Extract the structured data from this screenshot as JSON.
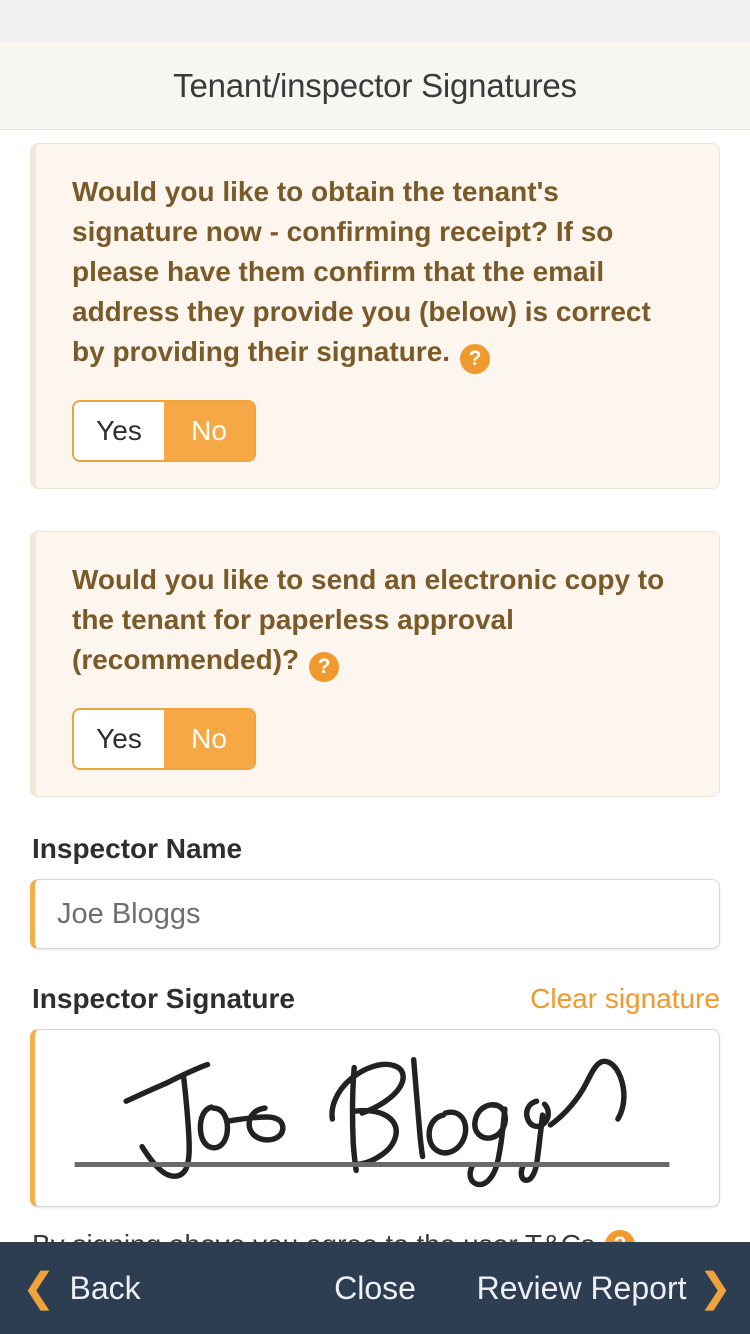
{
  "header": {
    "title": "Tenant/inspector Signatures"
  },
  "questions": [
    {
      "text": "Would you like to obtain the tenant's signature now - confirming receipt? If so please have them confirm that the email address they provide you (below) is correct by providing their signature.",
      "help_icon": "question-mark-icon",
      "help_glyph": "?",
      "options": [
        {
          "label": "Yes",
          "selected": false
        },
        {
          "label": "No",
          "selected": true
        }
      ]
    },
    {
      "text": "Would you like to send an electronic copy to the tenant for paperless approval (recommended)?",
      "help_icon": "question-mark-icon",
      "help_glyph": "?",
      "options": [
        {
          "label": "Yes",
          "selected": false
        },
        {
          "label": "No",
          "selected": true
        }
      ]
    }
  ],
  "inspector_name": {
    "label": "Inspector Name",
    "value": "Joe Bloggs",
    "placeholder": "Inspector Name"
  },
  "inspector_signature": {
    "label": "Inspector Signature",
    "clear_label": "Clear signature",
    "signature_text": "Joe Bloggs"
  },
  "terms": {
    "text": "By signing above you agree to the user T&Cs",
    "help_icon": "question-mark-icon",
    "help_glyph": "?"
  },
  "bottom_nav": {
    "back_label": "Back",
    "close_label": "Close",
    "review_label": "Review Report",
    "chevron_left": "❮",
    "chevron_right": "❯"
  },
  "colors": {
    "accent_orange": "#F0A33C",
    "selected_orange": "#F5A843",
    "question_brown": "#7A5A28",
    "card_bg": "#FDF6EE",
    "navbar_navy": "#2E3E52",
    "header_bg": "#F7F6F0"
  }
}
